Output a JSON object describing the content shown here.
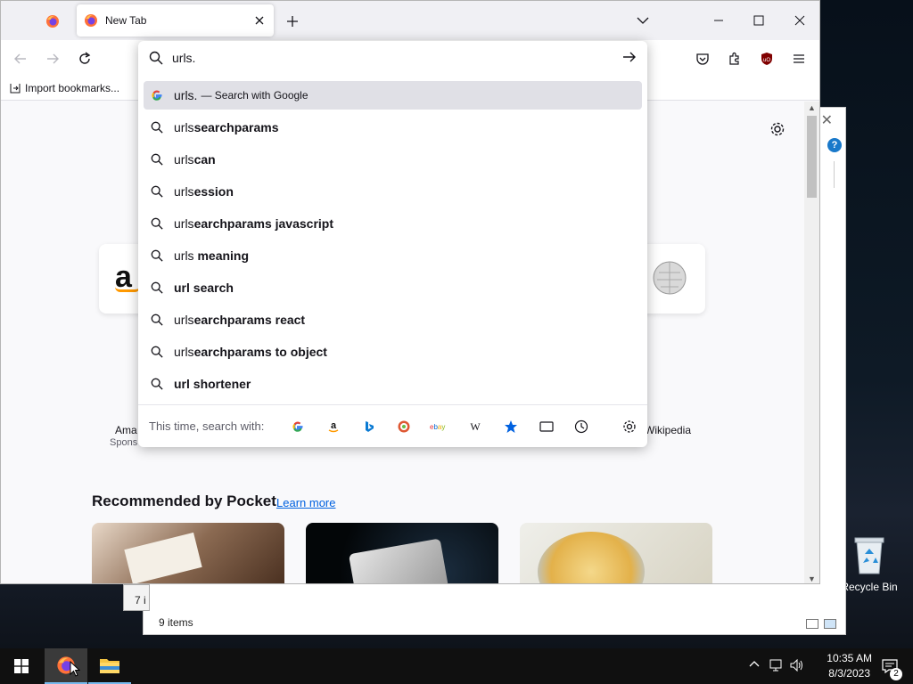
{
  "desktop": {
    "recycle_bin_label": "Recycle Bin"
  },
  "explorer": {
    "status_items": "9 items",
    "tooltip_fragment": "7 i"
  },
  "browser": {
    "pinned_tab_icon": "firefox-icon",
    "tab": {
      "title": "New Tab"
    },
    "bookmarks": {
      "import_label": "Import bookmarks..."
    },
    "urlbar": {
      "value": "urls.",
      "suggestions": [
        {
          "prefix": "urls.",
          "bold": "",
          "sub": "— Search with Google",
          "icon": "google-icon",
          "selected": true
        },
        {
          "prefix": "url",
          "bold": "searchparams",
          "pre": "urls",
          "icon": "search-icon"
        },
        {
          "prefix": "urls",
          "bold": "can",
          "icon": "search-icon"
        },
        {
          "prefix": "urls",
          "bold": "ession",
          "icon": "search-icon"
        },
        {
          "prefix": "urls",
          "bold": "earchparams javascript",
          "icon": "search-icon"
        },
        {
          "prefix": "urls ",
          "bold": "meaning",
          "icon": "search-icon"
        },
        {
          "prefix": "",
          "bold": "url search",
          "icon": "search-icon"
        },
        {
          "prefix": "urls",
          "bold": "earchparams react",
          "icon": "search-icon"
        },
        {
          "prefix": "urls",
          "bold": "earchparams to object",
          "icon": "search-icon"
        },
        {
          "prefix": "",
          "bold": "url shortener",
          "icon": "search-icon"
        }
      ],
      "search_with_label": "This time, search with:",
      "engines": [
        "google",
        "amazon",
        "bing",
        "duckduckgo",
        "ebay",
        "wikipedia",
        "bookmarks",
        "tabs",
        "history",
        "settings"
      ]
    },
    "shortcuts": [
      {
        "label": "Ama",
        "sub": "Spons"
      },
      {
        "label": "Wikipedia",
        "sub": ""
      }
    ],
    "pocket": {
      "title": "Recommended by Pocket",
      "learn_more": "Learn more"
    }
  },
  "taskbar": {
    "time": "10:35 AM",
    "date": "8/3/2023",
    "notification_count": "2"
  }
}
